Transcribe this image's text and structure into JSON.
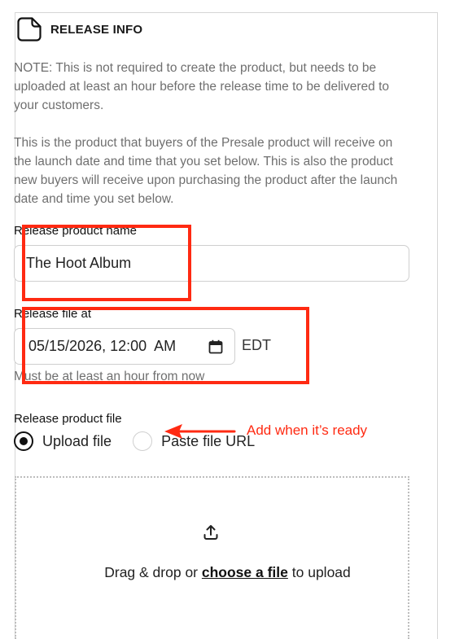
{
  "section": {
    "title": "RELEASE INFO",
    "icon": "note-icon"
  },
  "notes": {
    "required_note": "NOTE: This is not required to create the product, but needs to be uploaded at least an hour before the release time to be delivered to your customers.",
    "description": "This is the product that buyers of the Presale product will receive on the launch date and time that you set below. This is also the product new buyers will receive upon purchasing the product after the launch date and time you set below."
  },
  "release_product_name": {
    "label": "Release product name",
    "value": "The Hoot Album"
  },
  "release_file_at": {
    "label": "Release file at",
    "value": "05/15/2026, 12:00  AM",
    "timezone": "EDT",
    "helper": "Must be at least an hour from now"
  },
  "release_product_file": {
    "label": "Release product file",
    "options": [
      {
        "label": "Upload file",
        "checked": true
      },
      {
        "label": "Paste file URL",
        "checked": false
      }
    ]
  },
  "dropzone": {
    "prefix": "Drag & drop or ",
    "link": "choose a file",
    "suffix": " to upload",
    "icon": "upload-icon"
  },
  "annotation": {
    "text": "Add when it’s ready",
    "color": "#ff2a12"
  }
}
